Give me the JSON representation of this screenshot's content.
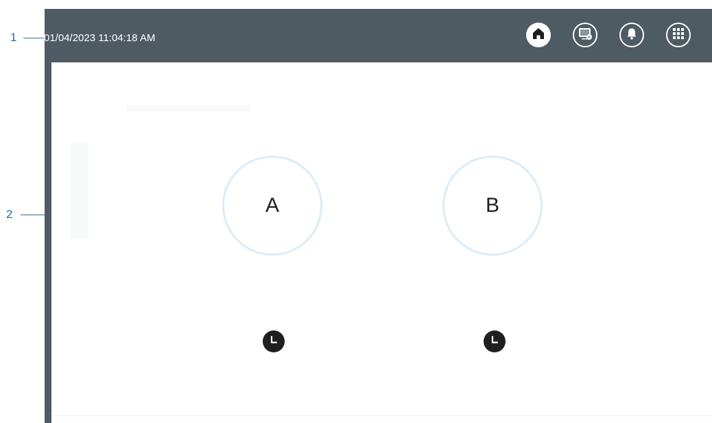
{
  "callouts": {
    "one": "1",
    "two": "2"
  },
  "status_bar": {
    "datetime": "01/04/2023 11:04:18 AM"
  },
  "icons": {
    "home": "home-icon",
    "screen": "screen-icon",
    "notifications": "bell-icon",
    "apps": "grid-icon",
    "clock": "clock-icon"
  },
  "channels": [
    {
      "label": "A"
    },
    {
      "label": "B"
    }
  ],
  "colors": {
    "topbar": "#4f5b63",
    "callout": "#2a6f9a",
    "channel_ring": "#d9ecf8",
    "clock_button": "#1f1f1f"
  }
}
